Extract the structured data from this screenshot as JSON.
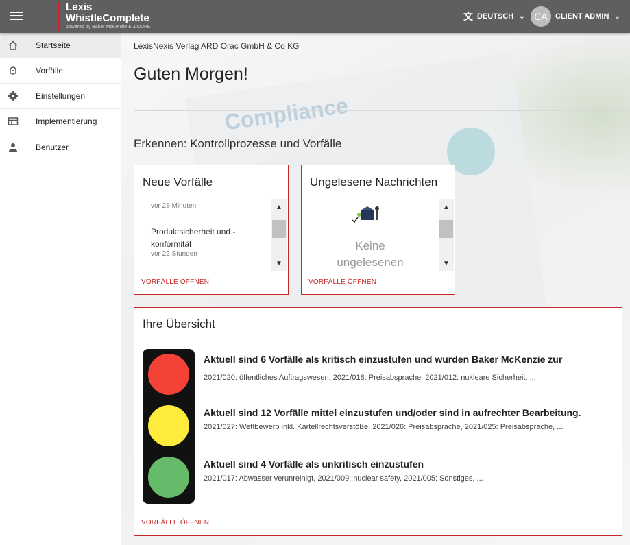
{
  "header": {
    "brand_line1": "Lexis",
    "brand_line2": "WhistleComplete",
    "brand_line3": "powered by Baker McKenzie & .LOUPE",
    "language": "DEUTSCH",
    "user_initials": "CA",
    "user_name": "CLIENT ADMIN"
  },
  "sidebar": {
    "items": [
      {
        "label": "Startseite",
        "icon": "home-icon"
      },
      {
        "label": "Vorfälle",
        "icon": "bell-icon"
      },
      {
        "label": "Einstellungen",
        "icon": "gear-icon"
      },
      {
        "label": "Implementierung",
        "icon": "table-icon"
      },
      {
        "label": "Benutzer",
        "icon": "person-icon"
      }
    ]
  },
  "main": {
    "company": "LexisNexis Verlag ARD Orac GmbH & Co KG",
    "greeting": "Guten Morgen!",
    "section_title": "Erkennen: Kontrollprozesse und Vorfälle",
    "new_incidents": {
      "title": "Neue Vorfälle",
      "items": [
        {
          "time": "vor 28 Minuten"
        },
        {
          "title": "Produktsicherheit und - konformität",
          "time": "vor 22 Stunden"
        }
      ],
      "link": "VORFÄLLE ÖFFNEN"
    },
    "unread_messages": {
      "title": "Ungelesene Nachrichten",
      "empty_text_1": "Keine",
      "empty_text_2": "ungelesenen",
      "link": "VORFÄLLE ÖFFNEN"
    },
    "overview": {
      "title": "Ihre Übersicht",
      "critical_heading": "Aktuell sind 6 Vorfälle als kritisch einzustufen und wurden Baker McKenzie zur",
      "critical_detail": "2021/020: öffentliches Auftragswesen, 2021/018: Preisabsprache, 2021/012: nukleare Sicherheit, ...",
      "medium_heading": "Aktuell sind 12 Vorfälle mittel einzustufen und/oder sind in aufrechter Bearbeitung.",
      "medium_detail": "2021/027: Wettbewerb inkl. Kartellrechtsverstöße, 2021/026: Preisabsprache, 2021/025: Preisabsprache, ...",
      "low_heading": "Aktuell sind 4 Vorfälle als unkritisch einzustufen",
      "low_detail": "2021/017: Abwasser verunreinigt, 2021/009: nuclear safety, 2021/005: Sonstiges, ...",
      "link": "VORFÄLLE ÖFFNEN"
    }
  },
  "colors": {
    "accent": "#c62828",
    "topbar": "#5f5f5f",
    "red_light": "#f44336",
    "yellow_light": "#ffeb3b",
    "green_light": "#66bb6a"
  }
}
